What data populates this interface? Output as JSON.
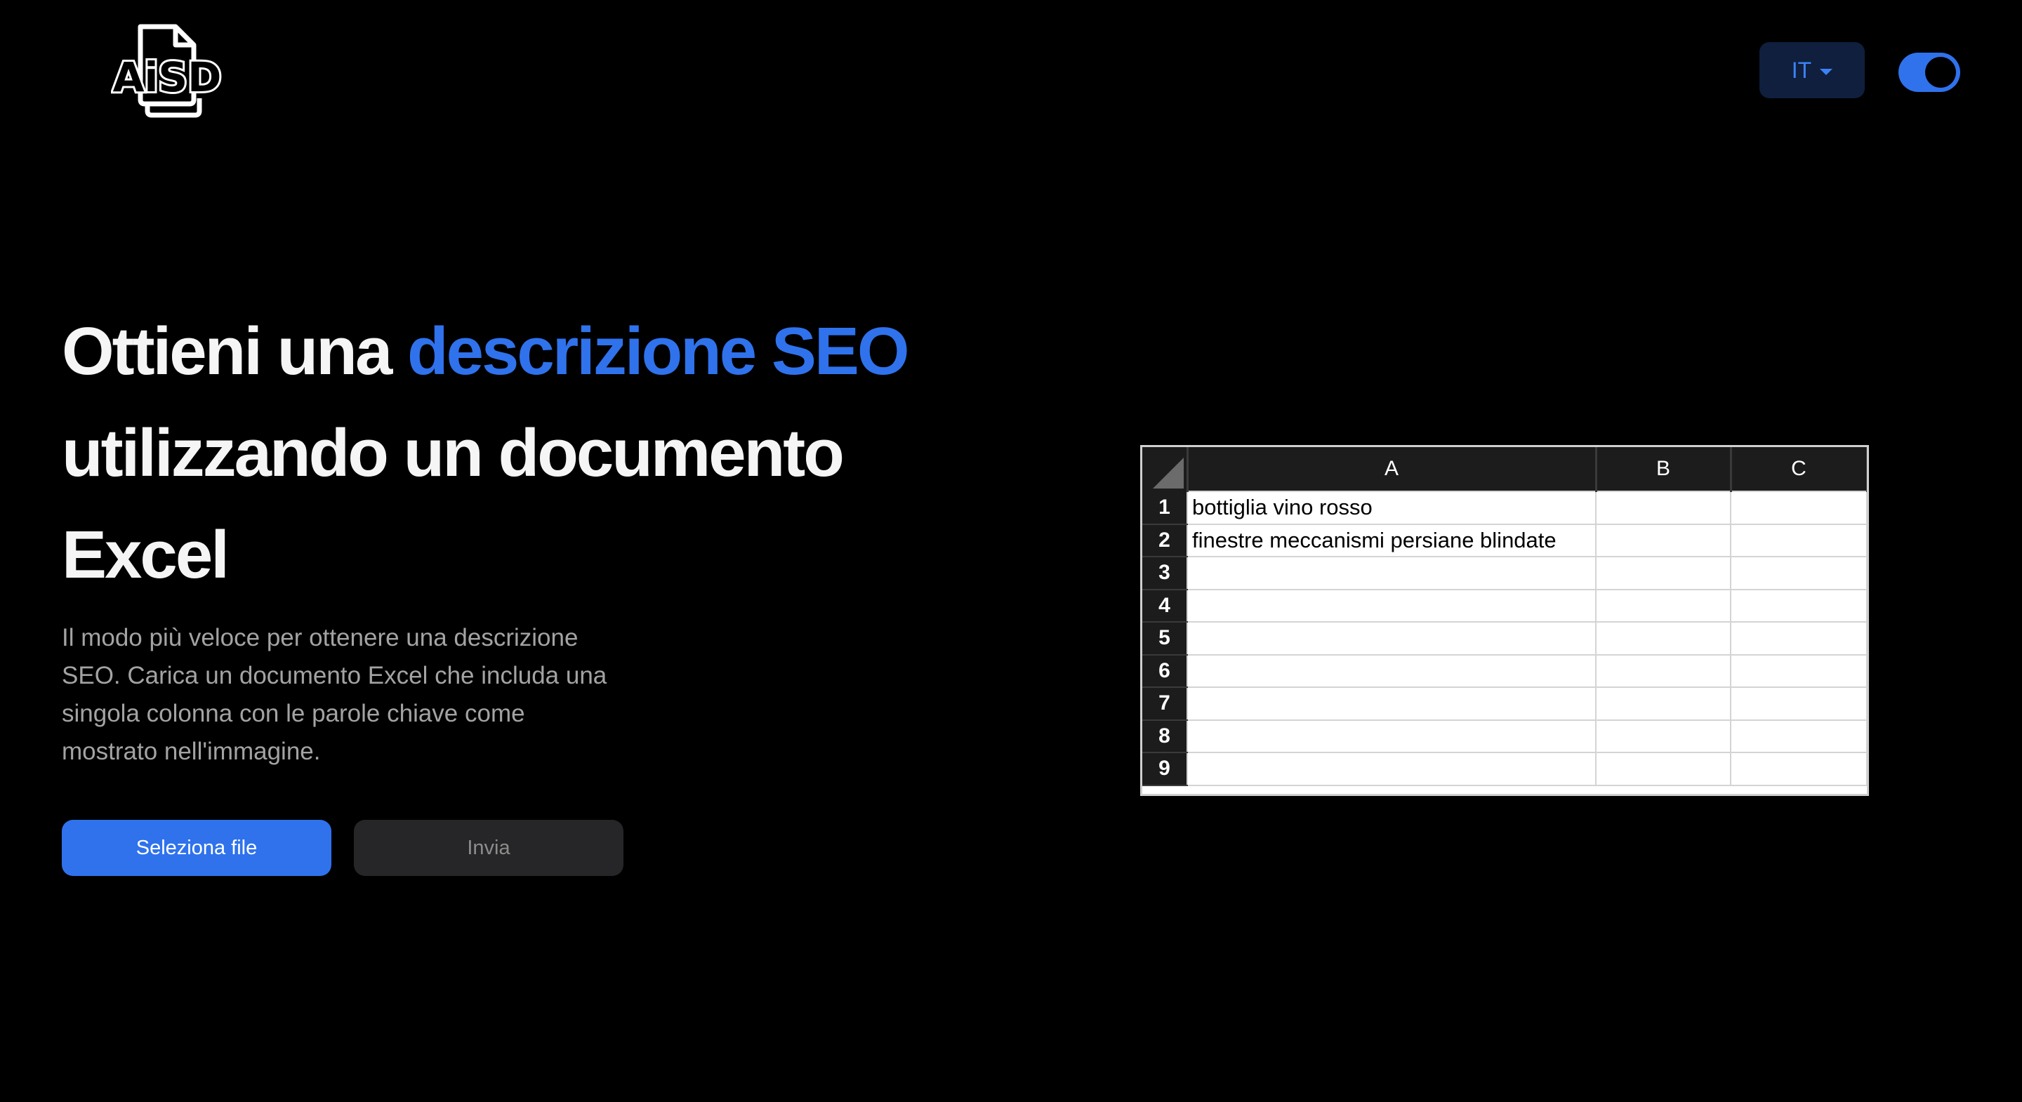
{
  "header": {
    "logo_text": "AiSD",
    "language": {
      "selected": "IT"
    },
    "theme_toggle": {
      "state": "on"
    }
  },
  "hero": {
    "title_part1": "Ottieni una ",
    "title_accent": "descrizione SEO",
    "title_part2": "utilizzando un documento Excel",
    "description": "Il modo più veloce per ottenere una descrizione SEO. Carica un documento Excel che includa una singola colonna con le parole chiave come mostrato nell'immagine.",
    "select_file_label": "Seleziona file",
    "submit_label": "Invia"
  },
  "spreadsheet": {
    "columns": [
      "A",
      "B",
      "C"
    ],
    "rows": [
      {
        "num": "1",
        "cells": [
          "bottiglia vino rosso",
          "",
          ""
        ]
      },
      {
        "num": "2",
        "cells": [
          "finestre meccanismi persiane blindate",
          "",
          ""
        ]
      },
      {
        "num": "3",
        "cells": [
          "",
          "",
          ""
        ]
      },
      {
        "num": "4",
        "cells": [
          "",
          "",
          ""
        ]
      },
      {
        "num": "5",
        "cells": [
          "",
          "",
          ""
        ]
      },
      {
        "num": "6",
        "cells": [
          "",
          "",
          ""
        ]
      },
      {
        "num": "7",
        "cells": [
          "",
          "",
          ""
        ]
      },
      {
        "num": "8",
        "cells": [
          "",
          "",
          ""
        ]
      },
      {
        "num": "9",
        "cells": [
          "",
          "",
          ""
        ]
      }
    ]
  },
  "colors": {
    "background": "#000000",
    "accent": "#2f72ec",
    "lang_bg": "#0f1f3d",
    "secondary_button": "#262628",
    "body_text": "#a3a3a3"
  }
}
